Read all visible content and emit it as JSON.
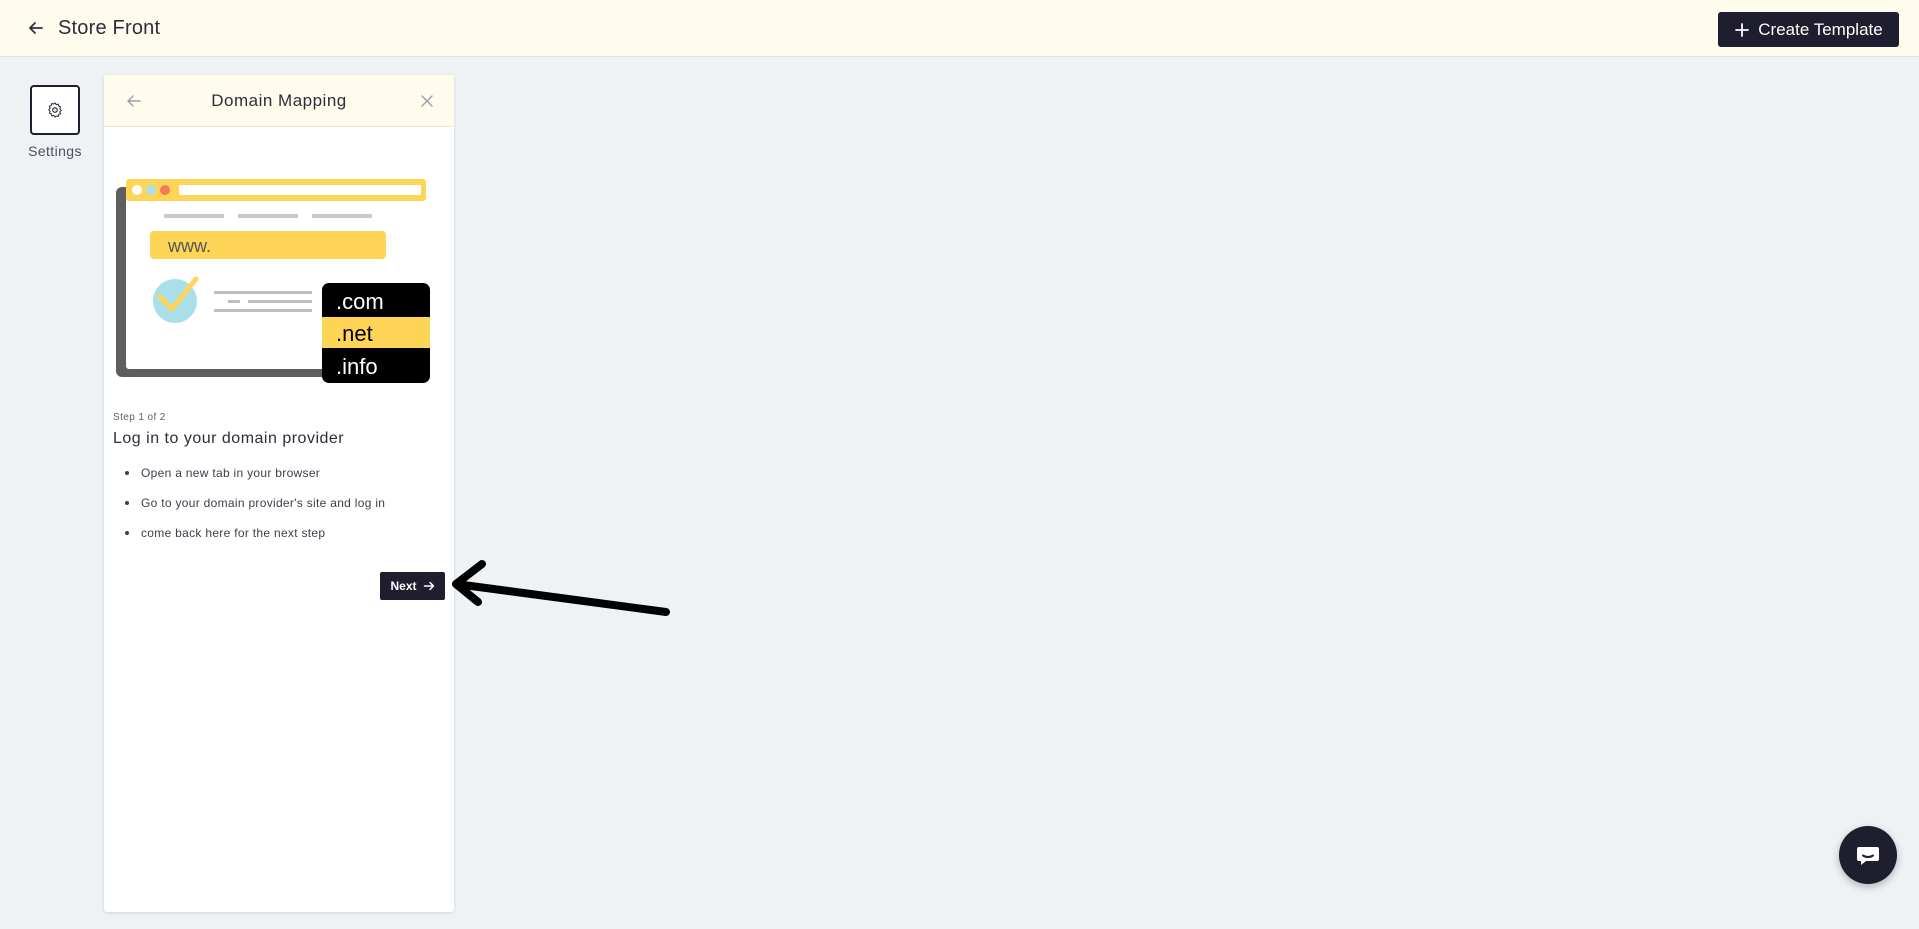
{
  "header": {
    "title": "Store Front",
    "create_button_label": "Create Template"
  },
  "rail": {
    "settings_label": "Settings"
  },
  "panel": {
    "title": "Domain Mapping",
    "illustration": {
      "url_prefix": "www.",
      "tlds": [
        ".com",
        ".net",
        ".info"
      ]
    },
    "step_meta": "Step 1 of 2",
    "step_title": "Log in to your domain provider",
    "steps": [
      "Open a new tab in your browser",
      "Go to your domain provider's site and log in",
      "come back here for the next step"
    ],
    "next_label": "Next"
  },
  "colors": {
    "topbar_bg": "#fffcee",
    "page_bg": "#eef2f5",
    "primary_dark": "#1e1e2e",
    "accent_yellow": "#ffd557"
  }
}
